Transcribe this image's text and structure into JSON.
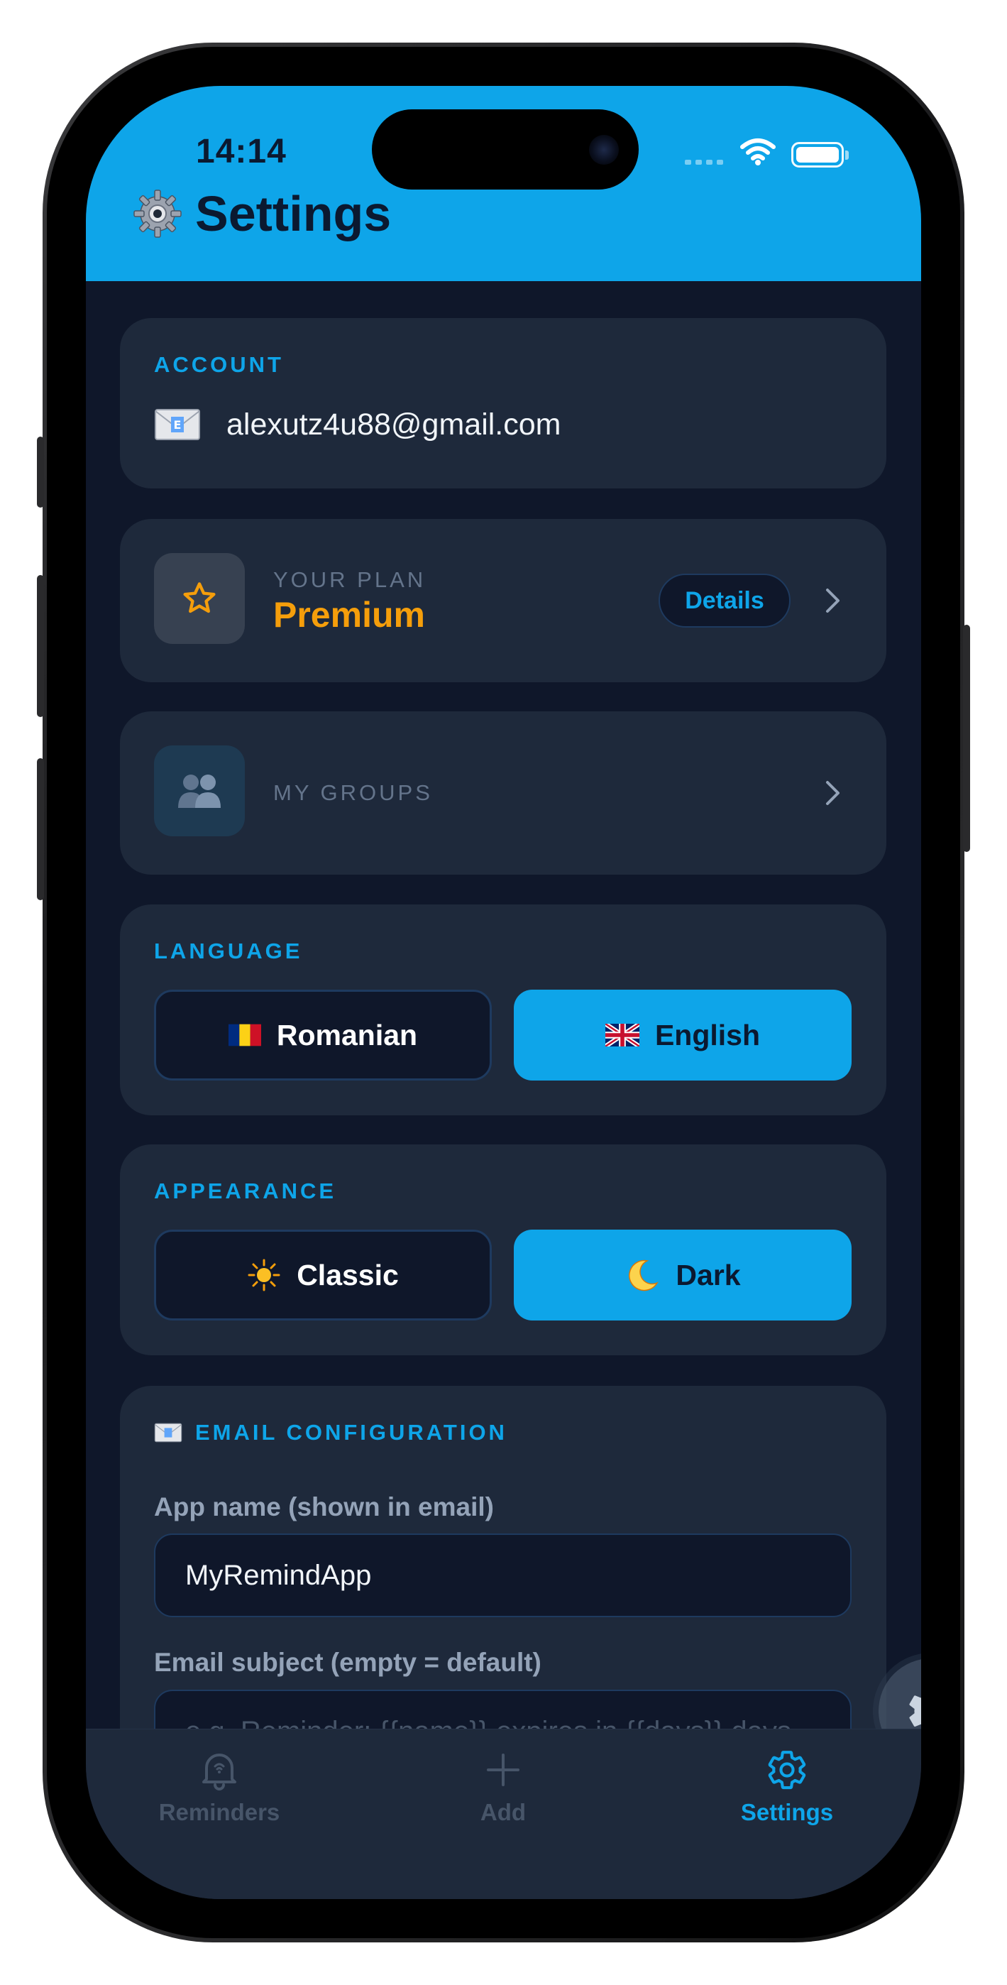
{
  "status_bar": {
    "time": "14:14"
  },
  "header": {
    "title": "Settings",
    "icon": "gear-icon"
  },
  "account": {
    "label": "ACCOUNT",
    "email": "alexutz4u88@gmail.com",
    "icon": "envelope-icon"
  },
  "plan": {
    "label": "YOUR PLAN",
    "name": "Premium",
    "details_button": "Details",
    "icon": "star-icon"
  },
  "groups": {
    "label": "MY GROUPS",
    "icon": "people-icon"
  },
  "language": {
    "label": "LANGUAGE",
    "options": [
      {
        "label": "Romanian",
        "flag": "romania-flag-icon",
        "selected": false
      },
      {
        "label": "English",
        "flag": "uk-flag-icon",
        "selected": true
      }
    ]
  },
  "appearance": {
    "label": "APPEARANCE",
    "options": [
      {
        "label": "Classic",
        "icon": "sun-icon",
        "selected": false
      },
      {
        "label": "Dark",
        "icon": "moon-icon",
        "selected": true
      }
    ]
  },
  "email_config": {
    "label": "EMAIL CONFIGURATION",
    "app_name_label": "App name (shown in email)",
    "app_name_value": "MyRemindApp",
    "subject_label": "Email subject (empty = default)",
    "subject_placeholder": "e.g. Reminder: {{name}} expires in {{days}} days"
  },
  "tabbar": {
    "tabs": [
      {
        "label": "Reminders",
        "icon": "bell-icon",
        "active": false
      },
      {
        "label": "Add",
        "icon": "plus-icon",
        "active": false
      },
      {
        "label": "Settings",
        "icon": "gear-icon",
        "active": true
      }
    ]
  },
  "colors": {
    "accent": "#0ea5e9",
    "background": "#0f172a",
    "card": "#1e293b",
    "premium": "#f59e0b"
  }
}
